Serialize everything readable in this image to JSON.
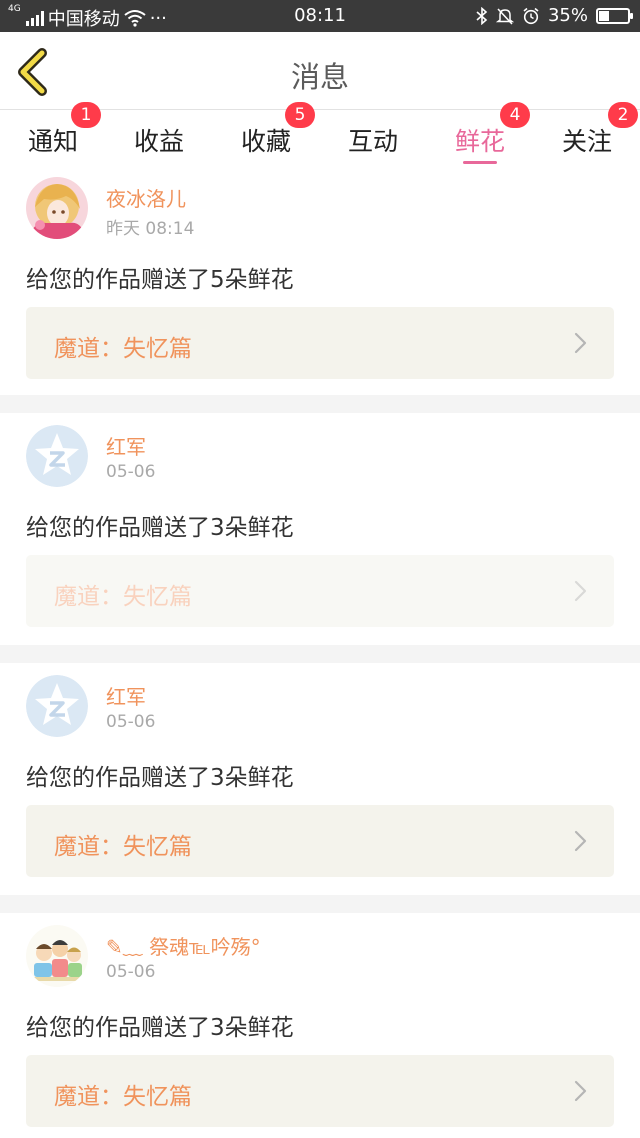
{
  "status_bar": {
    "network": "4G",
    "carrier": "中国移动",
    "more": "···",
    "time": "08:11",
    "battery": "35%",
    "battery_level": 0.35
  },
  "header": {
    "title": "消息"
  },
  "tabs": [
    {
      "label": "通知",
      "badge": "1",
      "active": false
    },
    {
      "label": "收益",
      "badge": "",
      "active": false
    },
    {
      "label": "收藏",
      "badge": "5",
      "active": false
    },
    {
      "label": "互动",
      "badge": "",
      "active": false
    },
    {
      "label": "鲜花",
      "badge": "4",
      "active": true
    },
    {
      "label": "关注",
      "badge": "2",
      "active": false
    }
  ],
  "messages": [
    {
      "user": "夜冰洛儿",
      "date": "昨天 08:14",
      "text": "给您的作品赠送了5朵鲜花",
      "work": "魔道：失忆篇",
      "avatar": "anime-avatar"
    },
    {
      "user": "红军",
      "date": "05-06",
      "text": "给您的作品赠送了3朵鲜花",
      "work": "魔道：失忆篇",
      "avatar": "default-star-avatar"
    },
    {
      "user": "红军",
      "date": "05-06",
      "text": "给您的作品赠送了3朵鲜花",
      "work": "魔道：失忆篇",
      "avatar": "default-star-avatar"
    },
    {
      "user": "✎﹏ 祭魂℡吟殇°",
      "date": "05-06",
      "text": "给您的作品赠送了3朵鲜花",
      "work": "魔道：失忆篇",
      "avatar": "cartoon-avatar"
    }
  ],
  "colors": {
    "accent": "#e8689a",
    "username": "#f0935c",
    "badge": "#ff3b4a"
  }
}
